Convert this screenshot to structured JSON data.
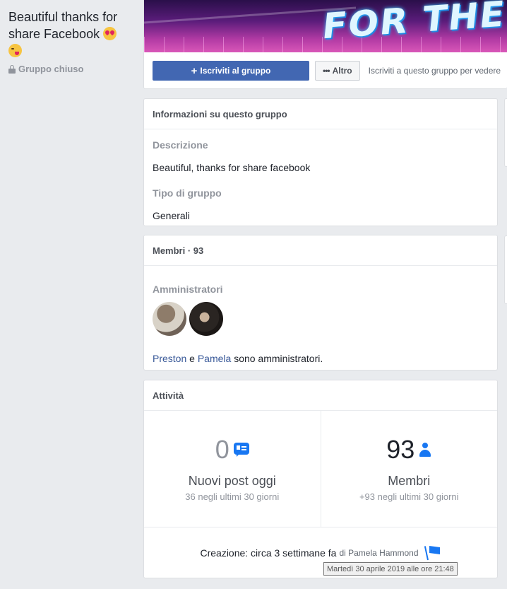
{
  "group": {
    "name": "Beautiful thanks for share Facebook",
    "status": "Gruppo chiuso",
    "cover_text": "FOR THE SHARE"
  },
  "actions": {
    "join_label": "Iscriviti al gruppo",
    "more_label": "Altro",
    "join_hint": "Iscriviti a questo gruppo per vedere"
  },
  "about": {
    "title": "Informazioni su questo gruppo",
    "description_label": "Descrizione",
    "description_text": "Beautiful, thanks for share facebook",
    "type_label": "Tipo di gruppo",
    "type_value": "Generali"
  },
  "members": {
    "title": "Membri · 93",
    "admins_label": "Amministratori",
    "admin_1": "Preston",
    "conjunction": "e",
    "admin_2": "Pamela",
    "admins_suffix": "sono amministratori."
  },
  "activity": {
    "title": "Attività",
    "posts_count": "0",
    "posts_label": "Nuovi post oggi",
    "posts_sub": "36 negli ultimi 30 giorni",
    "members_count": "93",
    "members_label": "Membri",
    "members_sub": "+93 negli ultimi 30 giorni",
    "creation_text": "Creazione: circa 3 settimane fa",
    "creation_by": "di Pamela Hammond",
    "tooltip": "Martedì 30 aprile 2019 alle ore 21:48"
  },
  "colors": {
    "primary_button": "#4267b2",
    "link": "#385898",
    "icon_blue": "#1877f2",
    "background": "#e9ebee"
  },
  "icons": [
    "lock-icon",
    "plus-icon",
    "dots-icon",
    "message-icon",
    "person-icon",
    "flag-icon"
  ]
}
